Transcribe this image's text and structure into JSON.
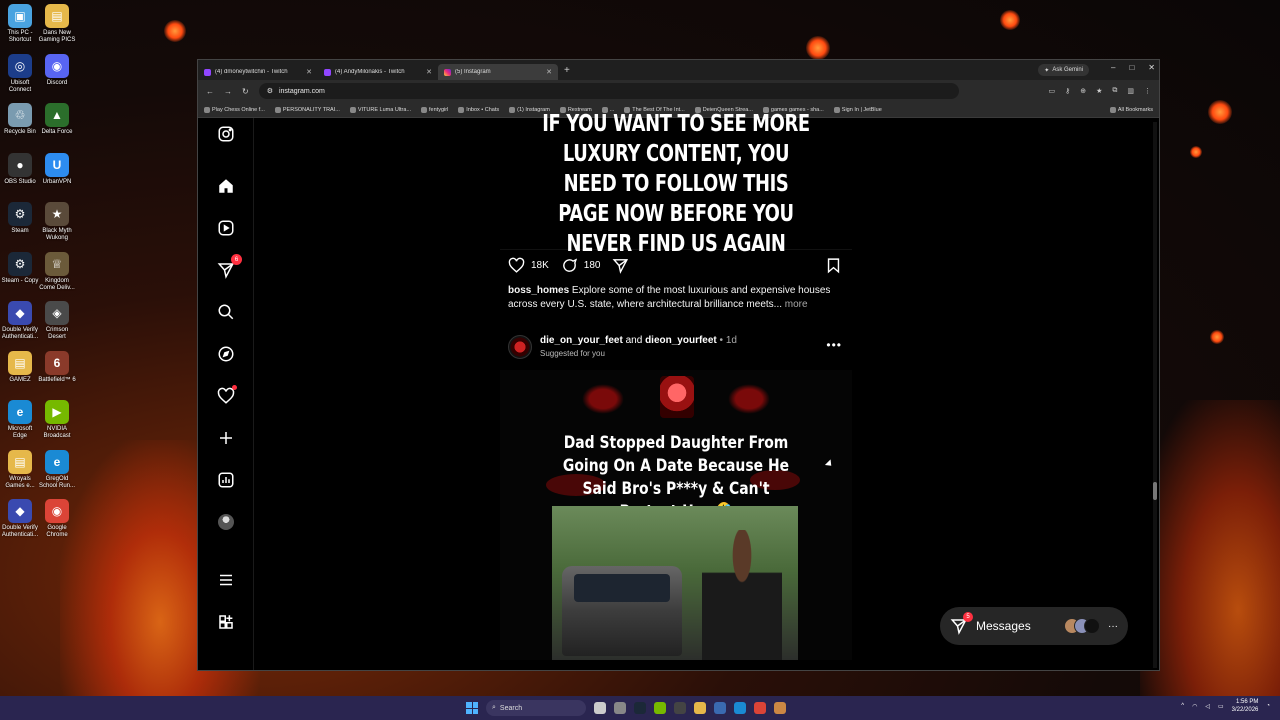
{
  "desktop": {
    "icons": [
      {
        "label": "This PC - Shortcut",
        "color": "#4aa3e0",
        "glyph": "▣"
      },
      {
        "label": "Dans New Gaming PICS",
        "color": "#e6b84a",
        "glyph": "▤"
      },
      {
        "label": "Ubisoft Connect",
        "color": "#1c3d8a",
        "glyph": "◎"
      },
      {
        "label": "Discord",
        "color": "#5865f2",
        "glyph": "◉"
      },
      {
        "label": "Recycle Bin",
        "color": "#7a9bb0",
        "glyph": "♲"
      },
      {
        "label": "Delta Force",
        "color": "#2b6e2b",
        "glyph": "▲"
      },
      {
        "label": "OBS Studio",
        "color": "#333333",
        "glyph": "●"
      },
      {
        "label": "UrbanVPN",
        "color": "#2d8cf0",
        "glyph": "U"
      },
      {
        "label": "Steam",
        "color": "#1b2838",
        "glyph": "⚙"
      },
      {
        "label": "Black Myth Wukong",
        "color": "#5a4a3a",
        "glyph": "★"
      },
      {
        "label": "Steam - Copy",
        "color": "#1b2838",
        "glyph": "⚙"
      },
      {
        "label": "Kingdom Come Deliv...",
        "color": "#6b5a3a",
        "glyph": "♕"
      },
      {
        "label": "Double Verify Authenticati...",
        "color": "#3a4ab0",
        "glyph": "◆"
      },
      {
        "label": "Crimson Desert",
        "color": "#4a4a4a",
        "glyph": "◈"
      },
      {
        "label": "GAMEZ",
        "color": "#e6b84a",
        "glyph": "▤"
      },
      {
        "label": "Battlefield™ 6",
        "color": "#8a3a2a",
        "glyph": "6"
      },
      {
        "label": "Microsoft Edge",
        "color": "#1a8ad4",
        "glyph": "e"
      },
      {
        "label": "NVIDIA Broadcast",
        "color": "#76b900",
        "glyph": "▶"
      },
      {
        "label": "Wroyals Games e...",
        "color": "#e6b84a",
        "glyph": "▤"
      },
      {
        "label": "GregOld School Run...",
        "color": "#1a8ad4",
        "glyph": "e"
      },
      {
        "label": "Double Verify Authenticati...",
        "color": "#3a4ab0",
        "glyph": "◆"
      },
      {
        "label": "Google Chrome",
        "color": "#db4437",
        "glyph": "◉"
      }
    ]
  },
  "browser": {
    "tabs": [
      {
        "title": "(4) dmoneytwitchin - Twitch",
        "active": false
      },
      {
        "title": "(4) AndyMilonakis - Twitch",
        "active": false
      },
      {
        "title": "(5) Instagram",
        "active": true
      }
    ],
    "new_tab": "+",
    "ask_gemini": "Ask Gemini",
    "window_controls": {
      "minimize": "–",
      "maximize": "□",
      "close": "✕"
    },
    "url": "instagram.com",
    "nav": {
      "back": "←",
      "forward": "→",
      "reload": "↻"
    },
    "bookmarks": [
      "Play Chess Online f...",
      "PERSONALITY TRAI...",
      "VITURE Luma Ultra...",
      "fentygirl",
      "Inbox • Chats",
      "(1) Instagram",
      "Restream",
      "...",
      "The Best Of The Int...",
      "DeienQueen Strea...",
      "games games - sha...",
      "Sign In | JetBlue",
      "All Bookmarks"
    ]
  },
  "instagram": {
    "nav_badges": {
      "notifications": "6"
    },
    "post1": {
      "image_text": "IF YOU WANT TO SEE MORE LUXURY CONTENT, YOU NEED TO FOLLOW THIS PAGE NOW BEFORE YOU NEVER FIND US AGAIN",
      "likes": "18K",
      "comments": "180",
      "username": "boss_homes",
      "caption": "Explore some of the most luxurious and expensive houses across every U.S. state, where architectural brilliance meets...",
      "more": "more"
    },
    "post2": {
      "user1": "die_on_your_feet",
      "and": "and",
      "user2": "dieon_yourfeet",
      "time": "1d",
      "separator": "•",
      "suggested": "Suggested for you",
      "headline": "Dad Stopped Daughter From Going On A Date Because He Said Bro's P***y & Can't Protect Her 🤣"
    },
    "messages": {
      "label": "Messages",
      "badge": "5"
    }
  },
  "taskbar": {
    "search_placeholder": "Search",
    "time": "1:56 PM",
    "date": "3/22/2026"
  }
}
